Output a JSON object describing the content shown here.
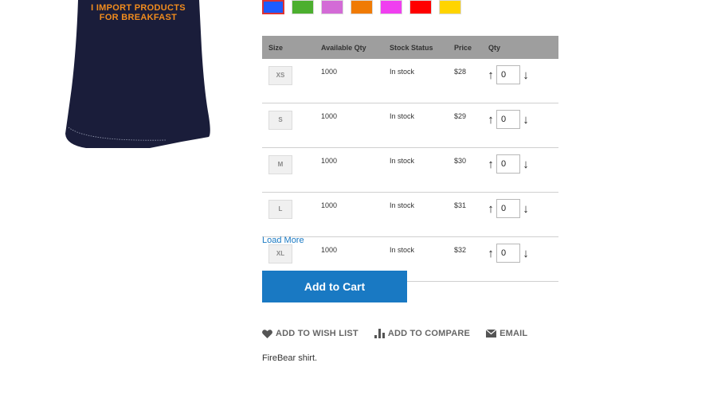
{
  "product": {
    "shirt_print_line1": "I IMPORT PRODUCTS",
    "shirt_print_line2": "FOR BREAKFAST",
    "description": "FireBear shirt."
  },
  "swatches": [
    {
      "color": "#1e5cff",
      "selected": true
    },
    {
      "color": "#4caf2f",
      "selected": false
    },
    {
      "color": "#d36bd6",
      "selected": false
    },
    {
      "color": "#f07b05",
      "selected": false
    },
    {
      "color": "#f03ff0",
      "selected": false
    },
    {
      "color": "#ff0000",
      "selected": false
    },
    {
      "color": "#ffd400",
      "selected": false
    }
  ],
  "table": {
    "headers": {
      "size": "Size",
      "available_qty": "Available Qty",
      "stock_status": "Stock Status",
      "price": "Price",
      "qty": "Qty"
    },
    "rows": [
      {
        "size": "XS",
        "available_qty": "1000",
        "stock_status": "In stock",
        "price": "$28",
        "qty": "0"
      },
      {
        "size": "S",
        "available_qty": "1000",
        "stock_status": "In stock",
        "price": "$29",
        "qty": "0"
      },
      {
        "size": "M",
        "available_qty": "1000",
        "stock_status": "In stock",
        "price": "$30",
        "qty": "0"
      },
      {
        "size": "L",
        "available_qty": "1000",
        "stock_status": "In stock",
        "price": "$31",
        "qty": "0"
      },
      {
        "size": "XL",
        "available_qty": "1000",
        "stock_status": "In stock",
        "price": "$32",
        "qty": "0"
      }
    ],
    "increment_glyph": "↑",
    "decrement_glyph": "↓"
  },
  "load_more": "Load More",
  "add_to_cart": "Add to Cart",
  "actions": {
    "wish_list": "ADD TO WISH LIST",
    "compare": "ADD TO COMPARE",
    "email": "EMAIL"
  },
  "colors": {
    "shirt": "#1a1d3a",
    "primary_button": "#1979c3",
    "table_header": "#9e9e9e",
    "print": "#f18c1d"
  }
}
